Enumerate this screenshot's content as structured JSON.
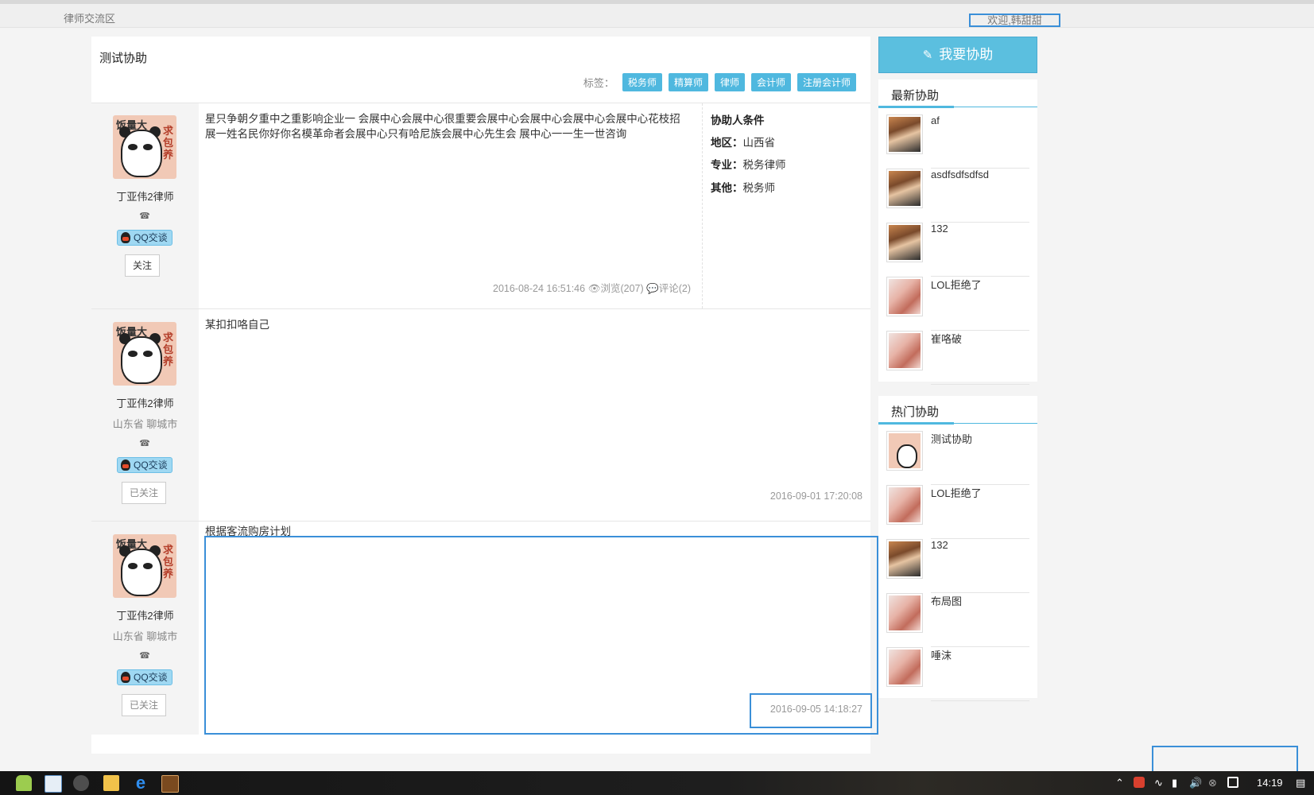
{
  "header": {
    "site_name": "律师交流区",
    "welcome": "欢迎,韩甜甜"
  },
  "topic": {
    "title": "测试协助",
    "tags_label": "标签：",
    "tags": [
      "税务师",
      "精算师",
      "律师",
      "会计师",
      "注册会计师"
    ]
  },
  "posts": [
    {
      "author": "丁亚伟2律师",
      "location": "",
      "qq_label": "QQ交谈",
      "follow_label": "关注",
      "content": "星只争朝夕重中之重影响企业一 会展中心会展中心很重要会展中心会展中心会展中心会展中心花枝招展一姓名民你好你名模革命者会展中心只有哈尼族会展中心先生会 展中心一一生一世咨询",
      "date": "2016-08-24 16:51:46",
      "views_label": "浏览",
      "views": "(207)",
      "comments_label": "评论",
      "comments": "(2)",
      "requirements": {
        "title": "协助人条件",
        "region_label": "地区：",
        "region": "山西省",
        "major_label": "专业：",
        "major": "税务律师",
        "other_label": "其他：",
        "other": "税务师"
      }
    },
    {
      "author": "丁亚伟2律师",
      "location": "山东省 聊城市",
      "qq_label": "QQ交谈",
      "follow_label": "已关注",
      "content": "某扣扣咯自己",
      "date": "2016-09-01 17:20:08"
    },
    {
      "author": "丁亚伟2律师",
      "location": "山东省 聊城市",
      "qq_label": "QQ交谈",
      "follow_label": "已关注",
      "content": "根据客流购房计划",
      "date": "2016-09-05 14:18:27"
    }
  ],
  "sidebar": {
    "help_button": "我要协助",
    "latest_title": "最新协助",
    "latest": [
      {
        "title": "af",
        "thumb": "boy"
      },
      {
        "title": "asdfsdfsdfsd",
        "thumb": "boy"
      },
      {
        "title": "132",
        "thumb": "boy"
      },
      {
        "title": "LOL拒绝了",
        "thumb": "dog"
      },
      {
        "title": "崔咯破",
        "thumb": "dog"
      }
    ],
    "hot_title": "热门协助",
    "hot": [
      {
        "title": "测试协助",
        "thumb": "panda"
      },
      {
        "title": "LOL拒绝了",
        "thumb": "dog"
      },
      {
        "title": "132",
        "thumb": "boy"
      },
      {
        "title": "布局图",
        "thumb": "dog"
      },
      {
        "title": "唾沫",
        "thumb": "dog"
      }
    ]
  },
  "avatar_text": {
    "left": "饭量大",
    "right": "求包养"
  },
  "taskbar": {
    "clock": "14:19"
  },
  "colors": {
    "accent": "#4fb8df",
    "highlight": "#3a8fd8"
  }
}
